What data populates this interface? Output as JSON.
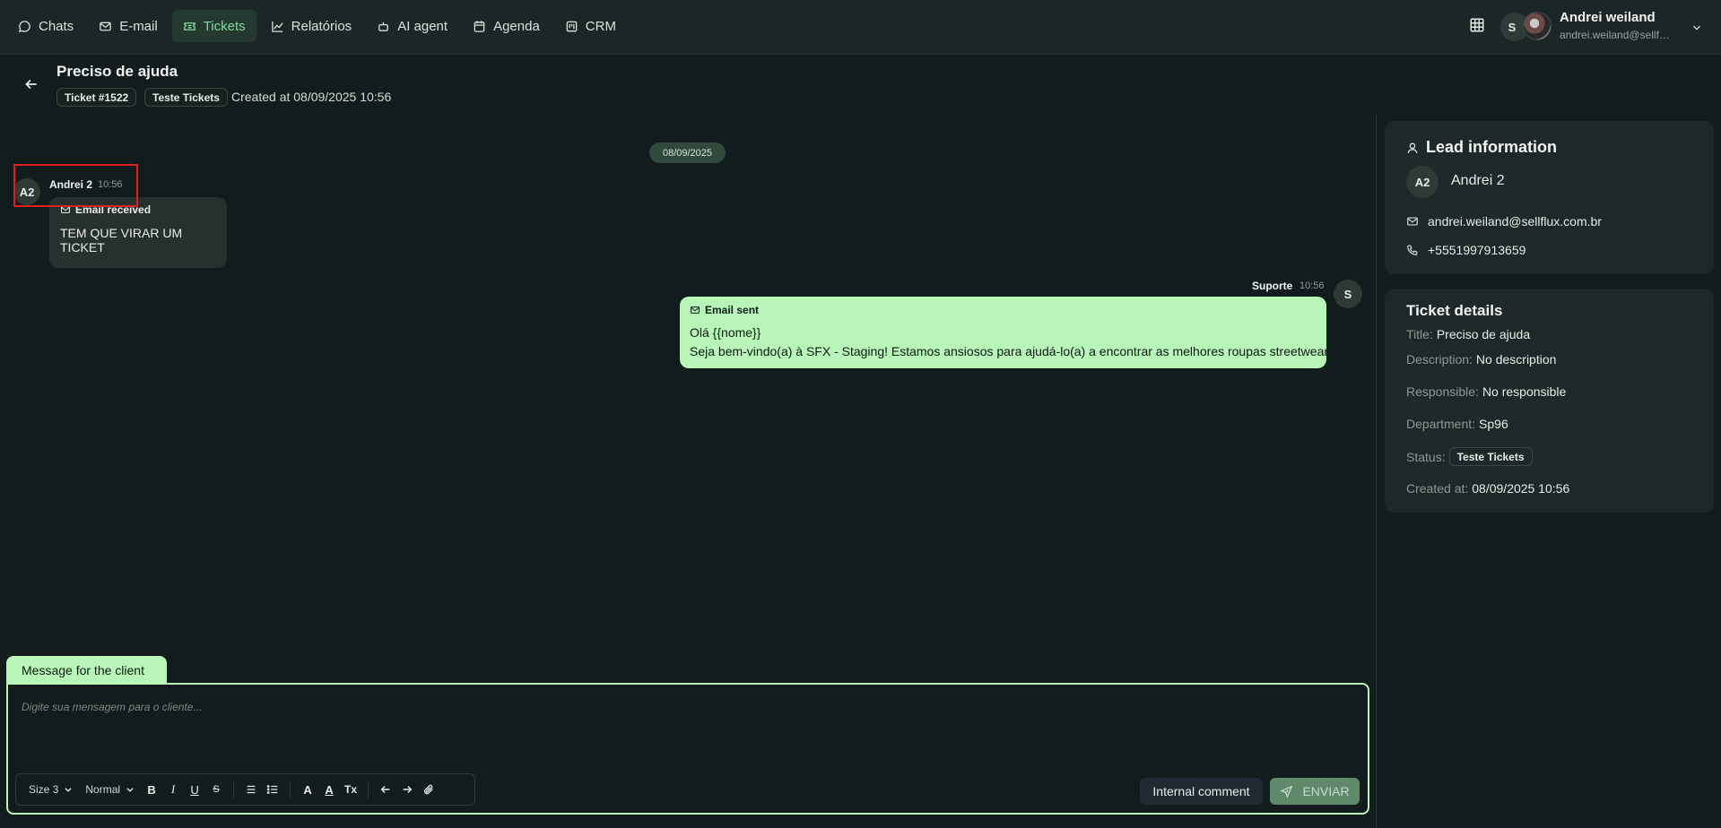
{
  "nav": {
    "items": [
      {
        "label": "Chats",
        "icon": "chat-icon"
      },
      {
        "label": "E-mail",
        "icon": "mail-icon"
      },
      {
        "label": "Tickets",
        "icon": "ticket-icon",
        "active": true
      },
      {
        "label": "Relatórios",
        "icon": "chart-icon"
      },
      {
        "label": "AI agent",
        "icon": "bot-icon"
      },
      {
        "label": "Agenda",
        "icon": "calendar-icon"
      },
      {
        "label": "CRM",
        "icon": "kanban-icon"
      }
    ]
  },
  "user": {
    "initials": "S",
    "name": "Andrei weiland",
    "email": "andrei.weiland@sellflux.com.br"
  },
  "ticket": {
    "title": "Preciso de ajuda",
    "number_tag": "Ticket #1522",
    "department_tag": "Teste Tickets",
    "created": "Created at 08/09/2025 10:56"
  },
  "chat": {
    "date": "08/09/2025",
    "incoming": {
      "avatar": "A2",
      "sender": "Andrei 2",
      "time": "10:56",
      "type_label": "Email received",
      "text": "TEM QUE VIRAR UM TICKET"
    },
    "outgoing": {
      "avatar": "S",
      "sender": "Suporte",
      "time": "10:56",
      "type_label": "Email sent",
      "line1": "Olá {{nome}}",
      "line2": "Seja bem-vindo(a) à SFX - Staging! Estamos ansiosos para ajudá-lo(a) a encontrar as melhores roupas streetwear."
    }
  },
  "lead": {
    "title": "Lead information",
    "avatar": "A2",
    "name": "Andrei 2",
    "email": "andrei.weiland@sellflux.com.br",
    "phone": "+5551997913659"
  },
  "details": {
    "title": "Ticket details",
    "title_label": "Title:",
    "title_value": "Preciso de ajuda",
    "description_label": "Description:",
    "description_value": "No description",
    "responsible_label": "Responsible:",
    "responsible_value": "No responsible",
    "department_label": "Department:",
    "department_value": "Sp96",
    "status_label": "Status:",
    "status_value": "Teste Tickets",
    "created_label": "Created at:",
    "created_value": "08/09/2025 10:56"
  },
  "composer": {
    "tab_label": "Message for the client",
    "placeholder": "Digite sua mensagem para o cliente...",
    "size_select": "Size 3",
    "style_select": "Normal",
    "bold": "B",
    "italic": "I",
    "underline": "U",
    "strike": "S",
    "font_color": "A",
    "bg_color": "A",
    "clear_format": "Tx",
    "internal_comment": "Internal comment",
    "send": "ENVIAR"
  },
  "colors": {
    "accent": "#b7f5b8",
    "active_nav": "#7fd9a1",
    "background": "#131c1c"
  }
}
